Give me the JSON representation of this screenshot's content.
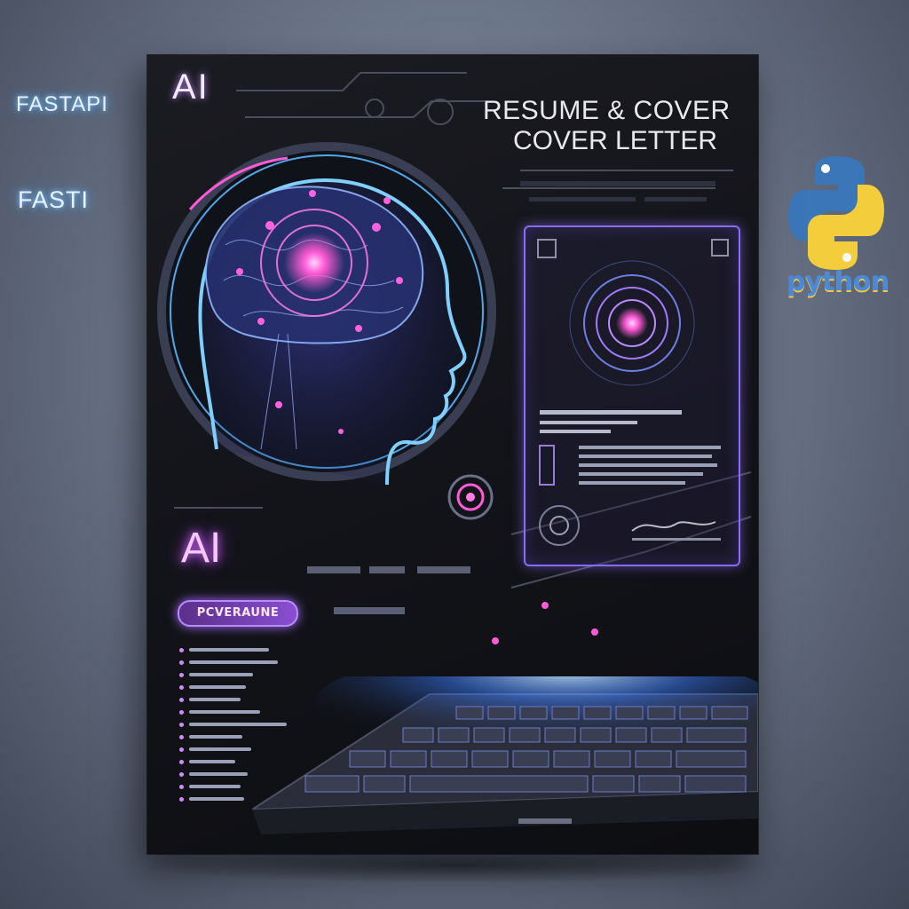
{
  "side_labels": {
    "fastapi": "FASTAPI",
    "fasti": "FASTI"
  },
  "python_logo": {
    "text": "python",
    "colors": {
      "blue": "#3b76b8",
      "yellow": "#f4cd3c"
    }
  },
  "poster": {
    "top_tag": "AI",
    "title_line1": "RESUME & COVER",
    "title_line2": "COVER LETTER",
    "mid_tag": "AI",
    "pill_label": "PCVERAUNE",
    "accent_colors": {
      "neon_blue": "#5ab8ff",
      "neon_pink": "#ff5bd6",
      "purple": "#8a6bff"
    }
  },
  "icons": [
    "brain-head-hologram-icon",
    "document-preview-icon",
    "laptop-keyboard-icon",
    "python-logo-icon",
    "target-rings-icon"
  ]
}
